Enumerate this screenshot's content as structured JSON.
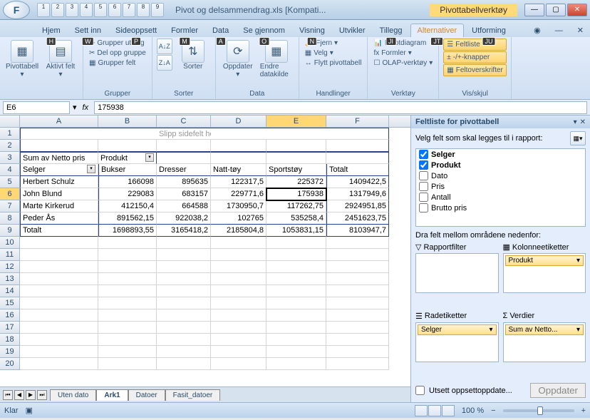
{
  "window": {
    "title": "Pivot og delsammendrag.xls  [Kompati...",
    "contextual_title": "Pivottabellverktøy"
  },
  "qat_numbers": [
    "1",
    "2",
    "3",
    "4",
    "5",
    "6",
    "7",
    "8",
    "9"
  ],
  "tabs": [
    "Hjem",
    "Sett inn",
    "Sideoppsett",
    "Formler",
    "Data",
    "Se gjennom",
    "Visning",
    "Utvikler",
    "Tillegg",
    "Alternativer",
    "Utforming"
  ],
  "tab_shortcuts": [
    "H",
    "W",
    "P",
    "M",
    "A",
    "O",
    "N",
    "JI",
    "JT",
    "JU"
  ],
  "ribbon": {
    "pivottabell": "Pivottabell",
    "aktivt_felt": "Aktivt felt",
    "grupper_utvalg": "Grupper utvalg",
    "del_opp_gruppe": "Del opp gruppe",
    "grupper_felt": "Grupper felt",
    "grupper": "Grupper",
    "sorter": "Sorter",
    "oppdater": "Oppdater",
    "endre_datakilde": "Endre datakilde",
    "data": "Data",
    "fjern": "Fjern",
    "velg": "Velg",
    "flytt": "Flytt pivottabell",
    "handlinger": "Handlinger",
    "pivotdiagram": "Pivotdiagram",
    "formler": "Formler",
    "olap": "OLAP-verktøy",
    "verktoy": "Verktøy",
    "feltliste": "Feltliste",
    "pmknapper": "-/+-knapper",
    "feltoverskr": "Feltoverskrifter",
    "vis_skjul": "Vis/skjul"
  },
  "formula": {
    "name_box": "E6",
    "fx": "fx",
    "value": "175938"
  },
  "columns": [
    "A",
    "B",
    "C",
    "D",
    "E",
    "F"
  ],
  "drop_hint": "Slipp sidefelt her",
  "pivot": {
    "corner": "Sum av Netto pris",
    "col_field": "Produkt",
    "row_field": "Selger",
    "col_labels": [
      "Bukser",
      "Dresser",
      "Natt-tøy",
      "Sportstøy",
      "Totalt"
    ],
    "rows": [
      {
        "name": "Herbert Schulz",
        "v": [
          "166098",
          "895635",
          "122317,5",
          "225372",
          "1409422,5"
        ]
      },
      {
        "name": "John Blund",
        "v": [
          "229083",
          "683157",
          "229771,6",
          "175938",
          "1317949,6"
        ]
      },
      {
        "name": "Marte Kirkerud",
        "v": [
          "412150,4",
          "664588",
          "1730950,7",
          "117262,75",
          "2924951,85"
        ]
      },
      {
        "name": "Peder Ås",
        "v": [
          "891562,15",
          "922038,2",
          "102765",
          "535258,4",
          "2451623,75"
        ]
      },
      {
        "name": "Totalt",
        "v": [
          "1698893,55",
          "3165418,2",
          "2185804,8",
          "1053831,15",
          "8103947,7"
        ]
      }
    ]
  },
  "sheet_tabs": [
    "Uten dato",
    "Ark1",
    "Datoer",
    "Fasit_datoer"
  ],
  "task_pane": {
    "title": "Feltliste for pivottabell",
    "hint": "Velg felt som skal legges til i rapport:",
    "fields": [
      {
        "name": "Selger",
        "checked": true
      },
      {
        "name": "Produkt",
        "checked": true
      },
      {
        "name": "Dato",
        "checked": false
      },
      {
        "name": "Pris",
        "checked": false
      },
      {
        "name": "Antall",
        "checked": false
      },
      {
        "name": "Brutto pris",
        "checked": false
      }
    ],
    "drag_hint": "Dra felt mellom områdene nedenfor:",
    "areas": {
      "report_filter": "Rapportfilter",
      "column_labels": "Kolonneetiketter",
      "row_labels": "Radetiketter",
      "values": "Verdier",
      "col_chip": "Produkt",
      "row_chip": "Selger",
      "val_chip": "Sum av Netto..."
    },
    "defer": "Utsett oppsettoppdate...",
    "update": "Oppdater"
  },
  "status": {
    "ready": "Klar",
    "zoom": "100 %"
  }
}
